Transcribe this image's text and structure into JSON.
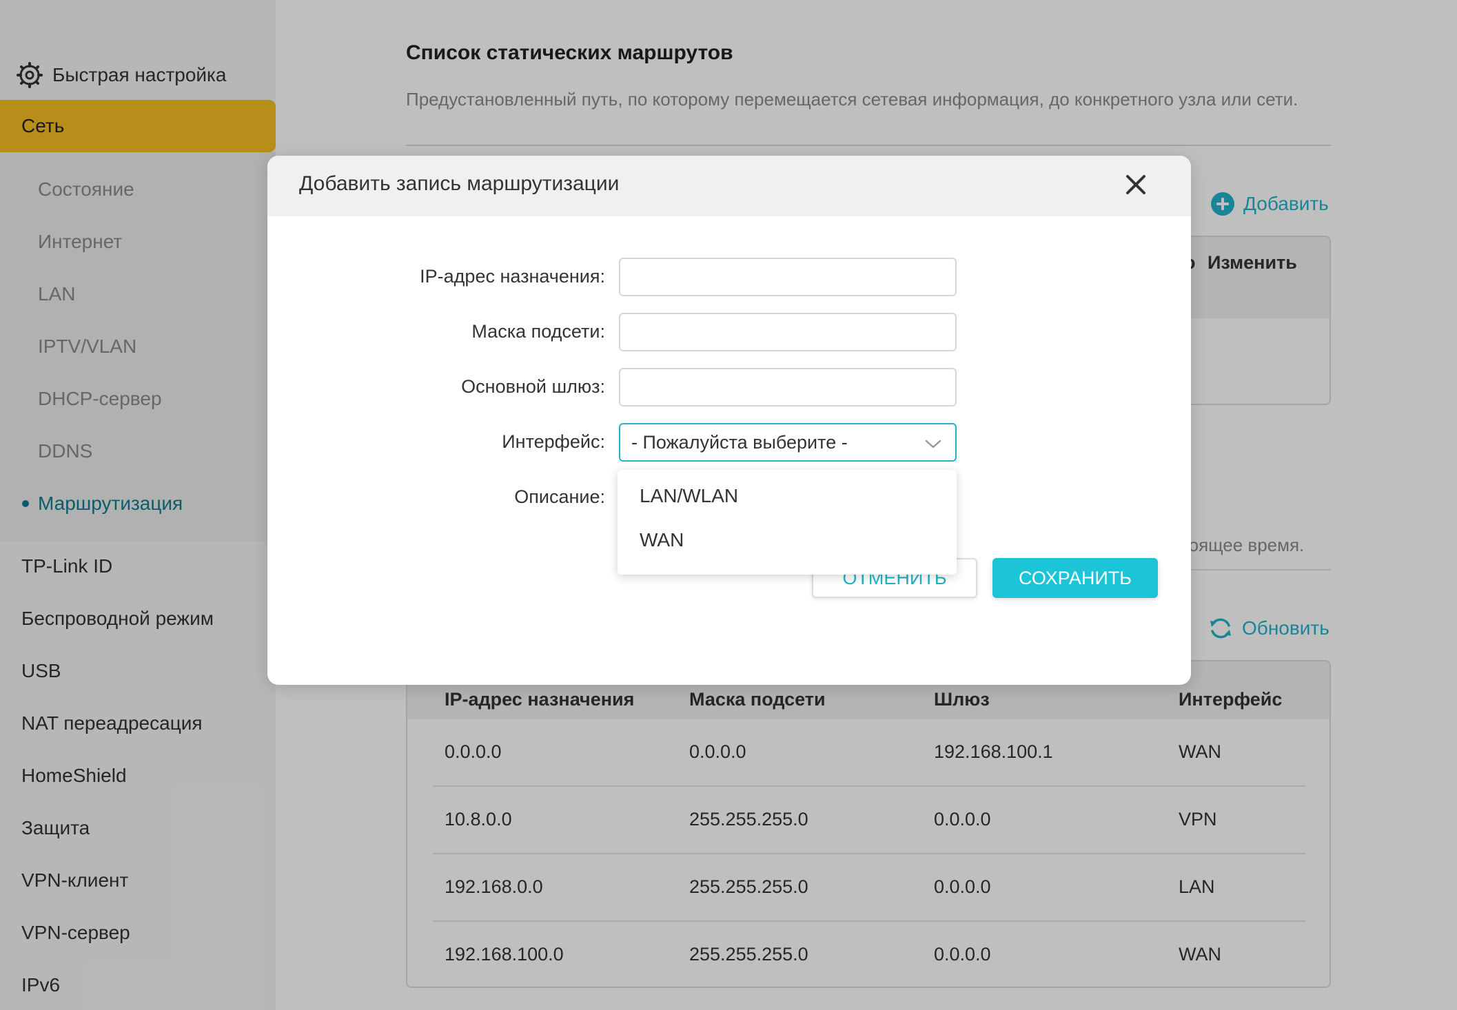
{
  "sidebar": {
    "quick_setup": "Быстрая настройка",
    "network": "Сеть",
    "sub_items": [
      "Состояние",
      "Интернет",
      "LAN",
      "IPTV/VLAN",
      "DHCP-сервер",
      "DDNS",
      "Маршрутизация"
    ],
    "main_items": [
      "TP-Link ID",
      "Беспроводной режим",
      "USB",
      "NAT переадресация",
      "HomeShield",
      "Защита",
      "VPN-клиент",
      "VPN-сервер",
      "IPv6"
    ]
  },
  "page": {
    "title": "Список статических маршрутов",
    "description": "Предустановленный путь, по которому перемещается сетевая информация, до конкретного узла или сети.",
    "add_label": "Добавить",
    "edit_header_pre": "о",
    "edit_header": "Изменить",
    "now_text": "стоящее время.",
    "refresh_label": "Обновить"
  },
  "routing_table": {
    "headers": [
      "IP-адрес назначения",
      "Маска подсети",
      "Шлюз",
      "Интерфейс"
    ],
    "rows": [
      [
        "0.0.0.0",
        "0.0.0.0",
        "192.168.100.1",
        "WAN"
      ],
      [
        "10.8.0.0",
        "255.255.255.0",
        "0.0.0.0",
        "VPN"
      ],
      [
        "192.168.0.0",
        "255.255.255.0",
        "0.0.0.0",
        "LAN"
      ],
      [
        "192.168.100.0",
        "255.255.255.0",
        "0.0.0.0",
        "WAN"
      ]
    ]
  },
  "modal": {
    "title": "Добавить запись маршрутизации",
    "fields": {
      "dest_ip_label": "IP-адрес назначения:",
      "subnet_label": "Маска подсети:",
      "gateway_label": "Основной шлюз:",
      "interface_label": "Интерфейс:",
      "description_label": "Описание:",
      "dest_ip_value": "",
      "subnet_value": "",
      "gateway_value": ""
    },
    "interface_selected": "- Пожалуйста выберите -",
    "interface_options": [
      "LAN/WLAN",
      "WAN"
    ],
    "cancel_label": "ОТМЕНИТЬ",
    "save_label": "СОХРАНИТЬ"
  },
  "colors": {
    "accent": "#20b3c9",
    "active_nav": "#f5be22",
    "save_button": "#1cc4d8"
  }
}
